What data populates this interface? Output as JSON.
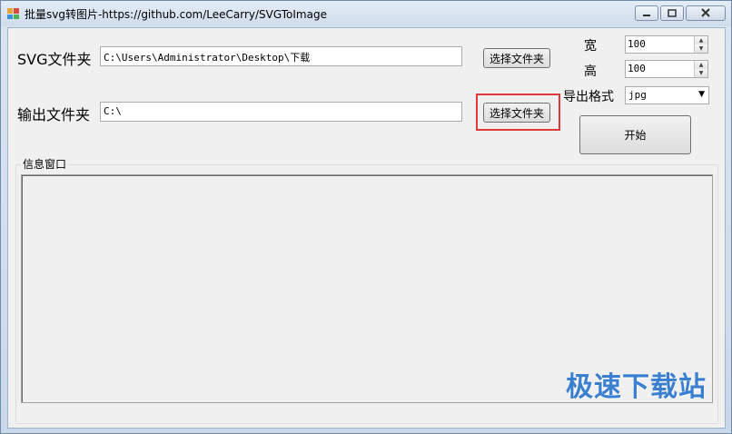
{
  "window": {
    "title": "批量svg转图片-https://github.com/LeeCarry/SVGToImage"
  },
  "form": {
    "svg_folder_label": "SVG文件夹",
    "svg_folder_value": "C:\\Users\\Administrator\\Desktop\\下载",
    "svg_browse_label": "选择文件夹",
    "output_folder_label": "输出文件夹",
    "output_folder_value": "C:\\",
    "output_browse_label": "选择文件夹",
    "width_label": "宽",
    "width_value": "100",
    "height_label": "高",
    "height_value": "100",
    "format_label": "导出格式",
    "format_value": "jpg",
    "start_label": "开始"
  },
  "info": {
    "group_label": "信息窗口"
  },
  "watermark": "极速下载站",
  "colors": {
    "highlight": "#e03a3a",
    "watermark": "#3b7fd0"
  }
}
